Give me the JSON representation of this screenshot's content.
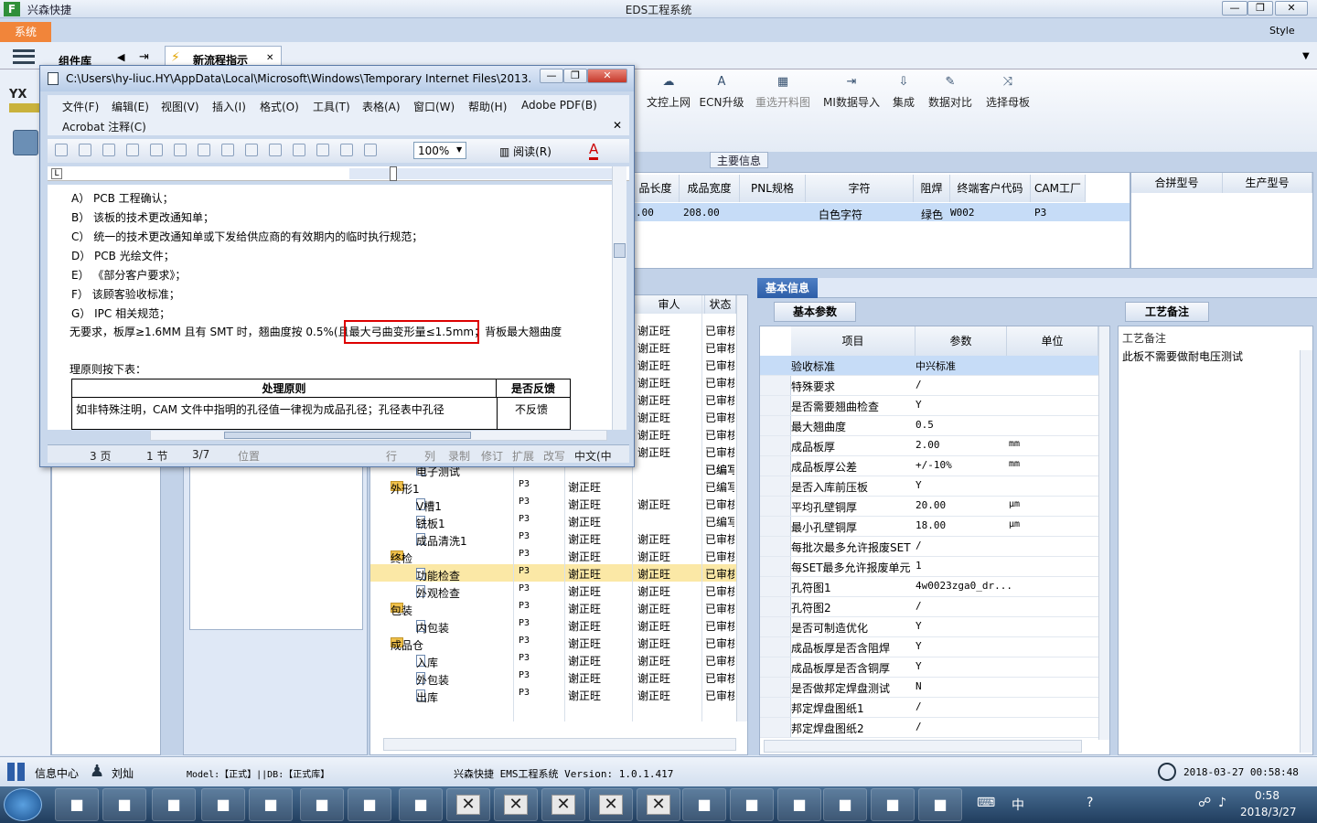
{
  "app": {
    "title": "兴森快捷",
    "window_title": "EDS工程系统",
    "system_tab": "系统",
    "style_label": "Style",
    "min": "—",
    "max": "❐",
    "close": "✕"
  },
  "tabs": {
    "component_lib": "组件库",
    "new_flow": "新流程指示",
    "close": "✕"
  },
  "ribbon": [
    {
      "label": "文控上网",
      "icon": "☁",
      "enabled": true
    },
    {
      "label": "ECN升级",
      "icon": "A",
      "enabled": true
    },
    {
      "label": "重选开料图",
      "icon": "▦",
      "enabled": false
    },
    {
      "label": "MI数据导入",
      "icon": "⇥",
      "enabled": true
    },
    {
      "label": "集成",
      "icon": "⇩",
      "enabled": true
    },
    {
      "label": "数据对比",
      "icon": "✎",
      "enabled": true
    },
    {
      "label": "选择母板",
      "icon": "⤨",
      "enabled": true
    }
  ],
  "main_info": {
    "group_label": "主要信息",
    "headers": [
      "品长度",
      "成品宽度",
      "PNL规格",
      "字符",
      "阻焊",
      "终端客户代码",
      "CAM工厂"
    ],
    "row": [
      ".00",
      "208.00",
      "",
      "白色字符",
      "绿色",
      "W002",
      "P3"
    ],
    "right_headers": [
      "合拼型号",
      "生产型号"
    ]
  },
  "basic_info": {
    "group_label": "基本信息",
    "sub_tab": "基本参数",
    "headers": [
      "项目",
      "参数",
      "单位"
    ],
    "rows": [
      {
        "k": "验收标准",
        "v": "中兴标准",
        "u": ""
      },
      {
        "k": "特殊要求",
        "v": "/",
        "u": ""
      },
      {
        "k": "是否需要翘曲检查",
        "v": "Y",
        "u": ""
      },
      {
        "k": "最大翘曲度",
        "v": "0.5",
        "u": ""
      },
      {
        "k": "成品板厚",
        "v": "2.00",
        "u": "mm"
      },
      {
        "k": "成品板厚公差",
        "v": "+/-10%",
        "u": "mm"
      },
      {
        "k": "是否入库前压板",
        "v": "Y",
        "u": ""
      },
      {
        "k": "平均孔壁铜厚",
        "v": "20.00",
        "u": "μm"
      },
      {
        "k": "最小孔壁铜厚",
        "v": "18.00",
        "u": "μm"
      },
      {
        "k": "每批次最多允许报废SET",
        "v": "/",
        "u": ""
      },
      {
        "k": "每SET最多允许报废单元",
        "v": "1",
        "u": ""
      },
      {
        "k": "孔符图1",
        "v": "4w0023zga0_dr...",
        "u": ""
      },
      {
        "k": "孔符图2",
        "v": "/",
        "u": ""
      },
      {
        "k": "是否可制造优化",
        "v": "Y",
        "u": ""
      },
      {
        "k": "成品板厚是否含阻焊",
        "v": "Y",
        "u": ""
      },
      {
        "k": "成品板厚是否含铜厚",
        "v": "Y",
        "u": ""
      },
      {
        "k": "是否做邦定焊盘测试",
        "v": "N",
        "u": ""
      },
      {
        "k": "邦定焊盘图纸1",
        "v": "/",
        "u": ""
      },
      {
        "k": "邦定焊盘图纸2",
        "v": "/",
        "u": ""
      }
    ]
  },
  "craft_notes": {
    "tab": "工艺备注",
    "header": "工艺备注",
    "text": "此板不需要做耐电压测试"
  },
  "tree": {
    "col_reviewer": "审人",
    "col_status": "状态",
    "upper_rows": [
      {
        "c2": "谢正旺",
        "c3": "谢正旺",
        "st": "已审核"
      },
      {
        "c2": "谢正旺",
        "c3": "谢正旺",
        "st": "已审核"
      },
      {
        "c2": "谢正旺",
        "c3": "谢正旺",
        "st": "已审核"
      },
      {
        "c2": "谢正旺",
        "c3": "谢正旺",
        "st": "已审核"
      },
      {
        "c2": "谢正旺",
        "c3": "谢正旺",
        "st": "已审核"
      },
      {
        "c2": "谢正旺",
        "c3": "谢正旺",
        "st": "已审核"
      },
      {
        "c2": "谢正旺",
        "c3": "谢正旺",
        "st": "已审核"
      },
      {
        "c2": "谢正旺",
        "c3": "谢正旺",
        "st": "已审核"
      },
      {
        "c2": "谢正旺",
        "c3": "",
        "st": "已编写"
      }
    ],
    "rows": [
      {
        "name": "电子测试",
        "type": "doc",
        "lvl": 2,
        "c1": "",
        "c2": "",
        "c3": "",
        "st": "已编写"
      },
      {
        "name": "外形1",
        "type": "fold",
        "lvl": 1,
        "c1": "P3",
        "c2": "谢正旺",
        "c3": "",
        "st": "已编写"
      },
      {
        "name": "V槽1",
        "type": "doc",
        "lvl": 2,
        "c1": "P3",
        "c2": "谢正旺",
        "c3": "谢正旺",
        "st": "已审核"
      },
      {
        "name": "铣板1",
        "type": "doc",
        "lvl": 2,
        "c1": "P3",
        "c2": "谢正旺",
        "c3": "",
        "st": "已编写"
      },
      {
        "name": "成品清洗1",
        "type": "doc",
        "lvl": 2,
        "c1": "P3",
        "c2": "谢正旺",
        "c3": "谢正旺",
        "st": "已审核"
      },
      {
        "name": "终检",
        "type": "fold",
        "lvl": 1,
        "c1": "P3",
        "c2": "谢正旺",
        "c3": "谢正旺",
        "st": "已审核"
      },
      {
        "name": "功能检查",
        "type": "doc",
        "lvl": 2,
        "c1": "P3",
        "c2": "谢正旺",
        "c3": "谢正旺",
        "st": "已审核",
        "hl": true
      },
      {
        "name": "外观检查",
        "type": "doc",
        "lvl": 2,
        "c1": "P3",
        "c2": "谢正旺",
        "c3": "谢正旺",
        "st": "已审核"
      },
      {
        "name": "包装",
        "type": "fold",
        "lvl": 1,
        "c1": "P3",
        "c2": "谢正旺",
        "c3": "谢正旺",
        "st": "已审核"
      },
      {
        "name": "内包装",
        "type": "doc",
        "lvl": 2,
        "c1": "P3",
        "c2": "谢正旺",
        "c3": "谢正旺",
        "st": "已审核"
      },
      {
        "name": "成品仓",
        "type": "fold",
        "lvl": 1,
        "c1": "P3",
        "c2": "谢正旺",
        "c3": "谢正旺",
        "st": "已审核"
      },
      {
        "name": "入库",
        "type": "doc",
        "lvl": 2,
        "c1": "P3",
        "c2": "谢正旺",
        "c3": "谢正旺",
        "st": "已审核"
      },
      {
        "name": "外包装",
        "type": "doc",
        "lvl": 2,
        "c1": "P3",
        "c2": "谢正旺",
        "c3": "谢正旺",
        "st": "已审核"
      },
      {
        "name": "出库",
        "type": "doc",
        "lvl": 2,
        "c1": "P3",
        "c2": "谢正旺",
        "c3": "谢正旺",
        "st": "已审核"
      }
    ]
  },
  "word": {
    "title": "C:\\Users\\hy-liuc.HY\\AppData\\Local\\Microsoft\\Windows\\Temporary Internet Files\\2013...",
    "menus": [
      "文件(F)",
      "编辑(E)",
      "视图(V)",
      "插入(I)",
      "格式(O)",
      "工具(T)",
      "表格(A)",
      "窗口(W)",
      "帮助(H)",
      "Adobe PDF(B)"
    ],
    "menu2": "Acrobat 注释(C)",
    "zoom": "100%",
    "read": "阅读(R)",
    "lines": [
      "A） PCB 工程确认；",
      "B） 该板的技术更改通知单；",
      "C） 统一的技术更改通知单或下发给供应商的有效期内的临时执行规范；",
      "D） PCB 光绘文件；",
      "E） 《部分客户要求》；",
      "F） 该顾客验收标准；",
      "G） IPC 相关规范；"
    ],
    "line_pre": "无要求，板厚≥1.6MM 且有 SMT 时，翘曲度按 0.5%(且",
    "line_boxed": "最大弓曲变形量≤1.5mm",
    "line_post": "；背板最大翘曲度",
    "line_handle": "理原则按下表：",
    "table_h1": "处理原则",
    "table_h2": "是否反馈",
    "table_c1": "如非特殊注明，CAM 文件中指明的孔径值一律视为成品孔径；孔径表中孔径",
    "table_c2": "不反馈",
    "status": {
      "page": "3 页",
      "section": "1 节",
      "pos": "3/7",
      "location": "位置",
      "row": "行",
      "col": "列",
      "rec": "录制",
      "rev": "修订",
      "ext": "扩展",
      "ovr": "改写",
      "lang": "中文(中"
    }
  },
  "statusbar": {
    "info_center": "信息中心",
    "user": "刘灿",
    "model": "Model:【正式】||DB:【正式库】",
    "product": "兴森快捷 EMS工程系统 Version: 1.0.1.417",
    "datetime": "2018-03-27 00:58:48"
  },
  "taskbar": {
    "time": "0:58",
    "date": "2018/3/27",
    "ime": "中"
  }
}
